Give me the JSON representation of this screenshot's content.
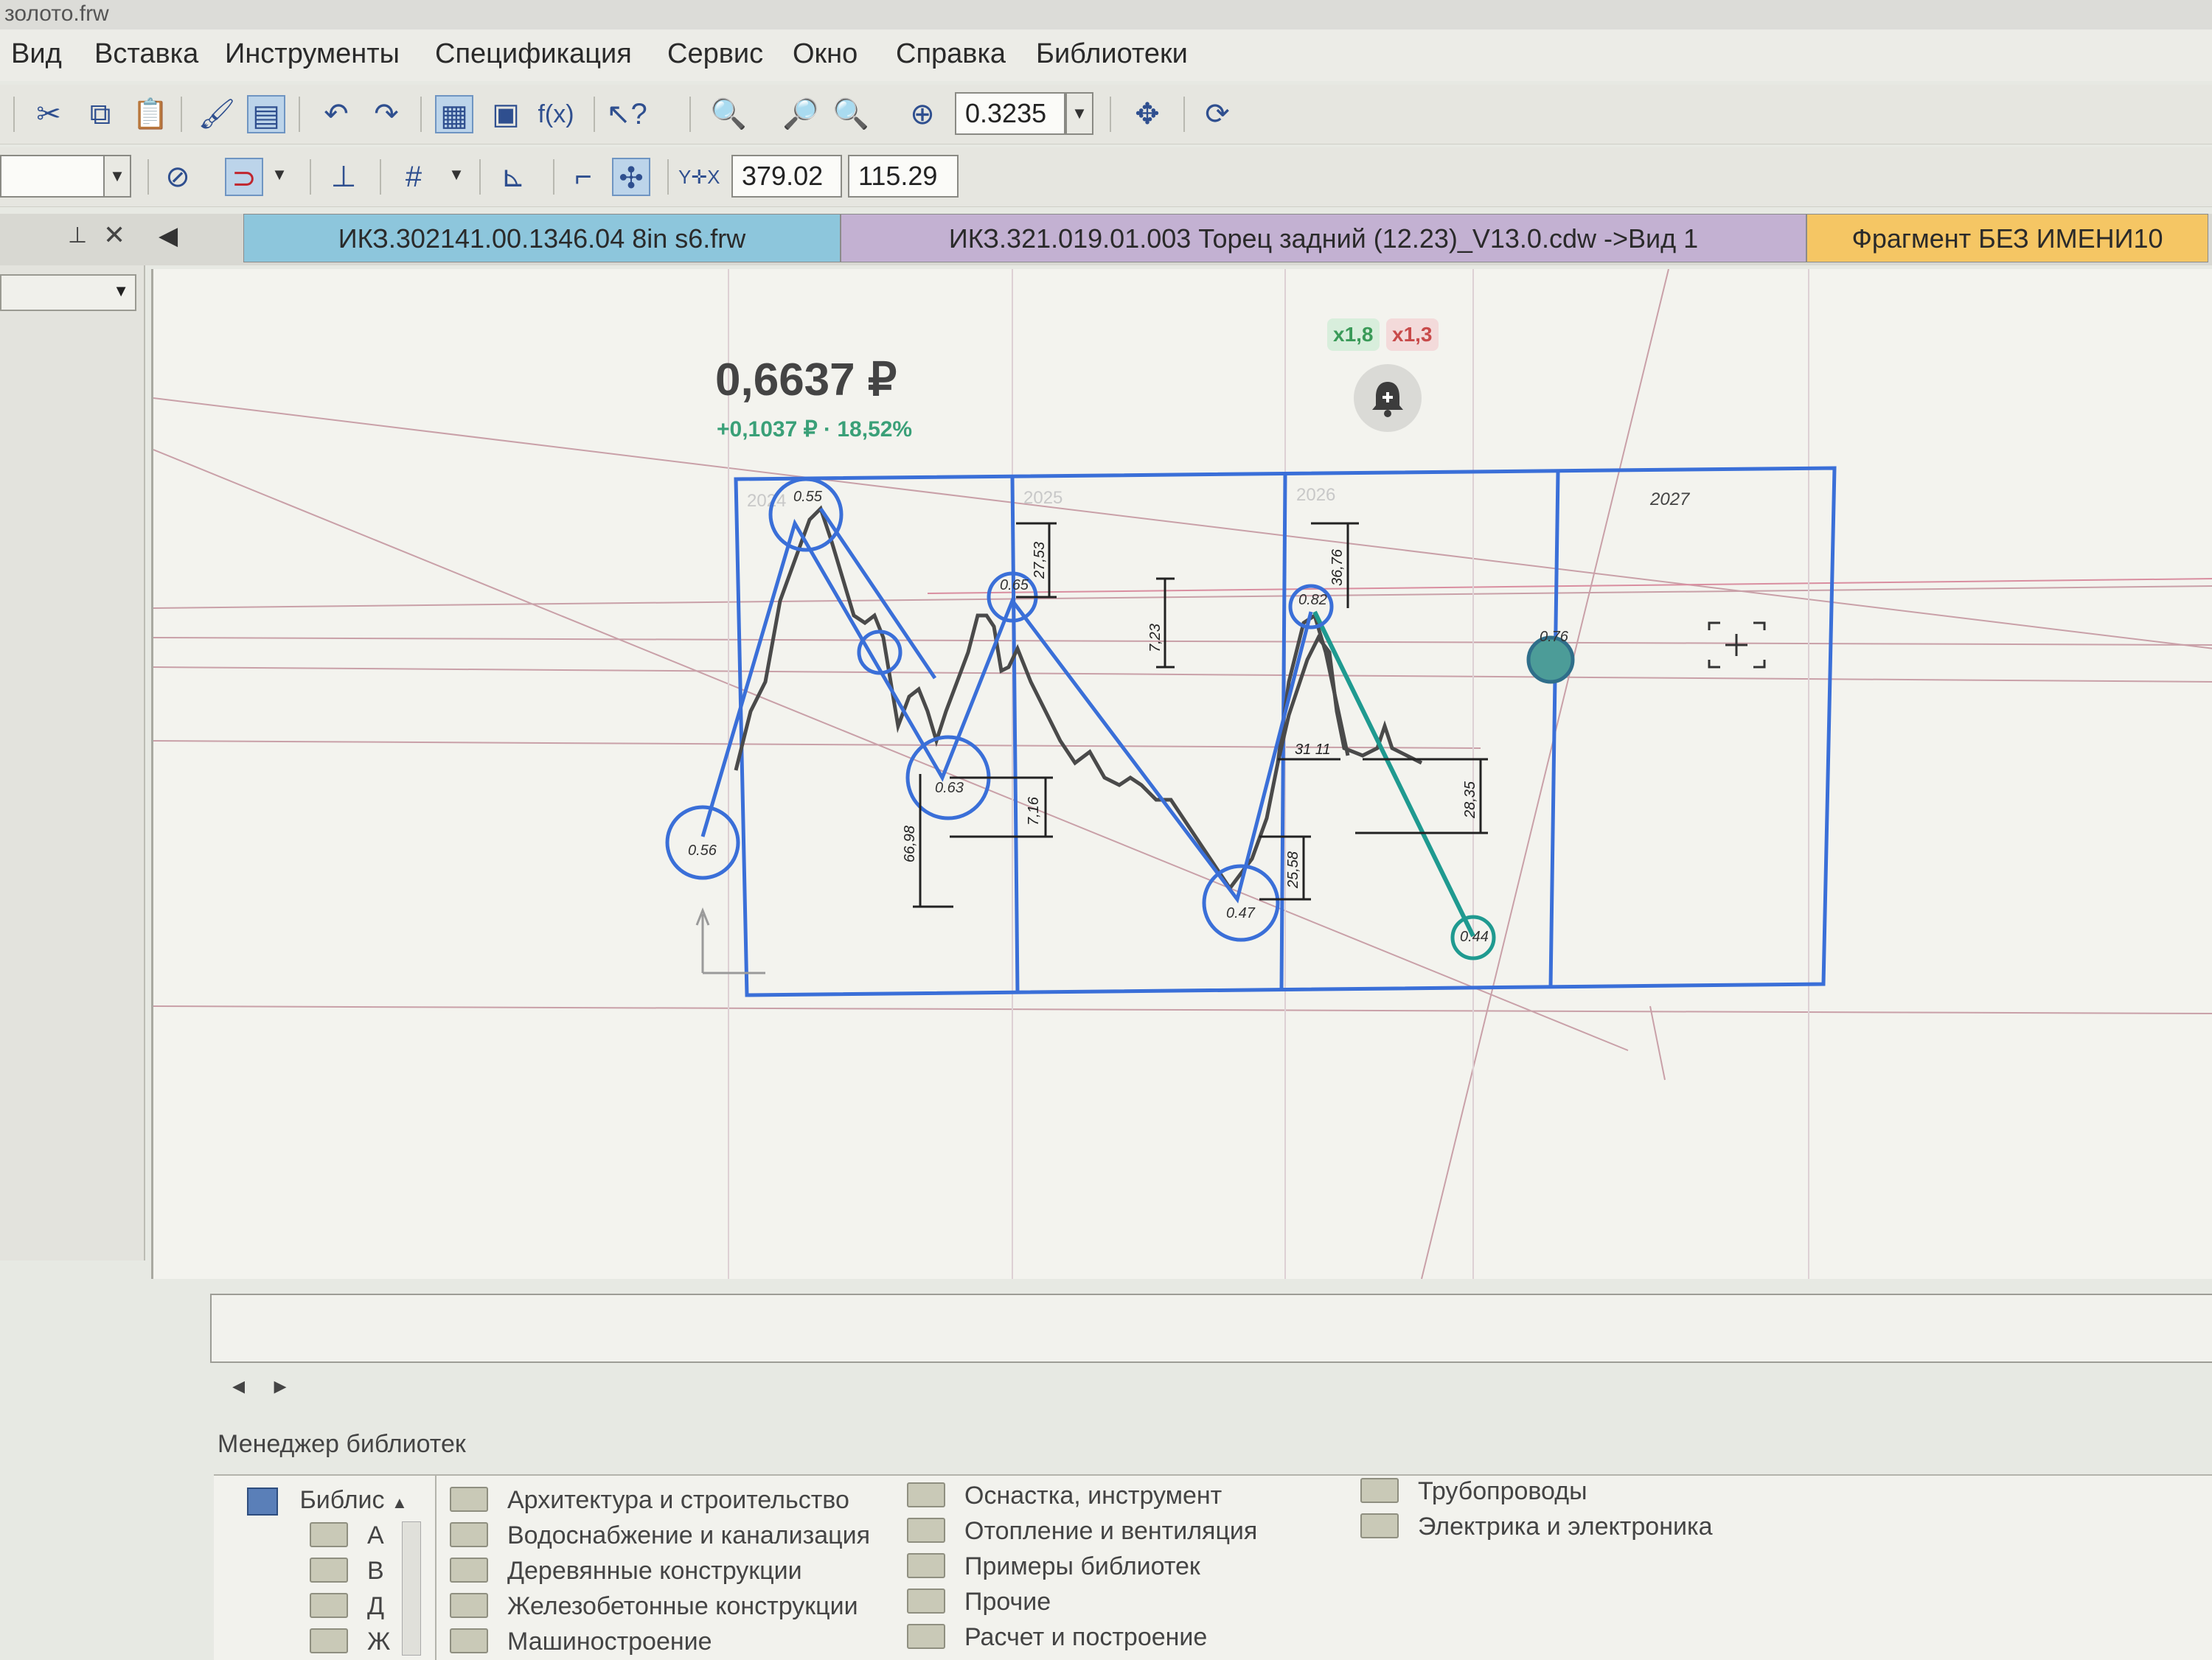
{
  "window": {
    "title": "золото.frw"
  },
  "menu": [
    "Вид",
    "Вставка",
    "Инструменты",
    "Спецификация",
    "Сервис",
    "Окно",
    "Справка",
    "Библиотеки"
  ],
  "toolbar1": {
    "zoom_value": "0.3235"
  },
  "toolbar2": {
    "coord_x": "379.02",
    "coord_y": "115.29"
  },
  "tabs": [
    "ИКЗ.302141.00.1346.04 8in s6.frw",
    "ИКЗ.321.019.01.003 Торец задний (12.23)_V13.0.cdw ->Вид 1",
    "Фрагмент БЕЗ ИМЕНИ10"
  ],
  "overlay": {
    "price": "0,6637 ₽",
    "change": "+0,1037 ₽ · 18,52%",
    "multiplier_green": "x1,8",
    "multiplier_red": "x1,3"
  },
  "drawing": {
    "year_labels": [
      "2024",
      "2025",
      "2026",
      "2027"
    ],
    "circle_labels": [
      "0.55",
      "0.65",
      "0.63",
      "0.56",
      "0.47",
      "0.82",
      "0.44",
      "0.76"
    ],
    "dimension_labels": [
      "27,53",
      "7,23",
      "36,76",
      "66,98",
      "7,16",
      "31 11",
      "28,35",
      "25,58"
    ]
  },
  "library": {
    "title": "Менеджер библиотек",
    "tree_root": "Библис",
    "tree_children": [
      "А",
      "В",
      "Д",
      "Ж"
    ],
    "col1": [
      "Архитектура и строительство",
      "Водоснабжение и канализация",
      "Деревянные конструкции",
      "Железобетонные конструкции",
      "Машиностроение"
    ],
    "col2": [
      "Оснастка, инструмент",
      "Отопление и вентиляция",
      "Примеры библиотек",
      "Прочие",
      "Расчет и построение"
    ],
    "col3": [
      "Трубопроводы",
      "Электрика и электроника"
    ]
  },
  "icons": [
    "cut-icon",
    "copy-icon",
    "paste-icon",
    "undo-icon",
    "redo-icon",
    "zoom-icon",
    "pan-icon",
    "refresh-icon",
    "grid-icon",
    "bell-icon"
  ],
  "colors": {
    "selection_blue": "#3a6fd8",
    "teal_line": "#1f9a90",
    "guide_line": "#c9a0a8",
    "price_green": "#3aa078"
  }
}
